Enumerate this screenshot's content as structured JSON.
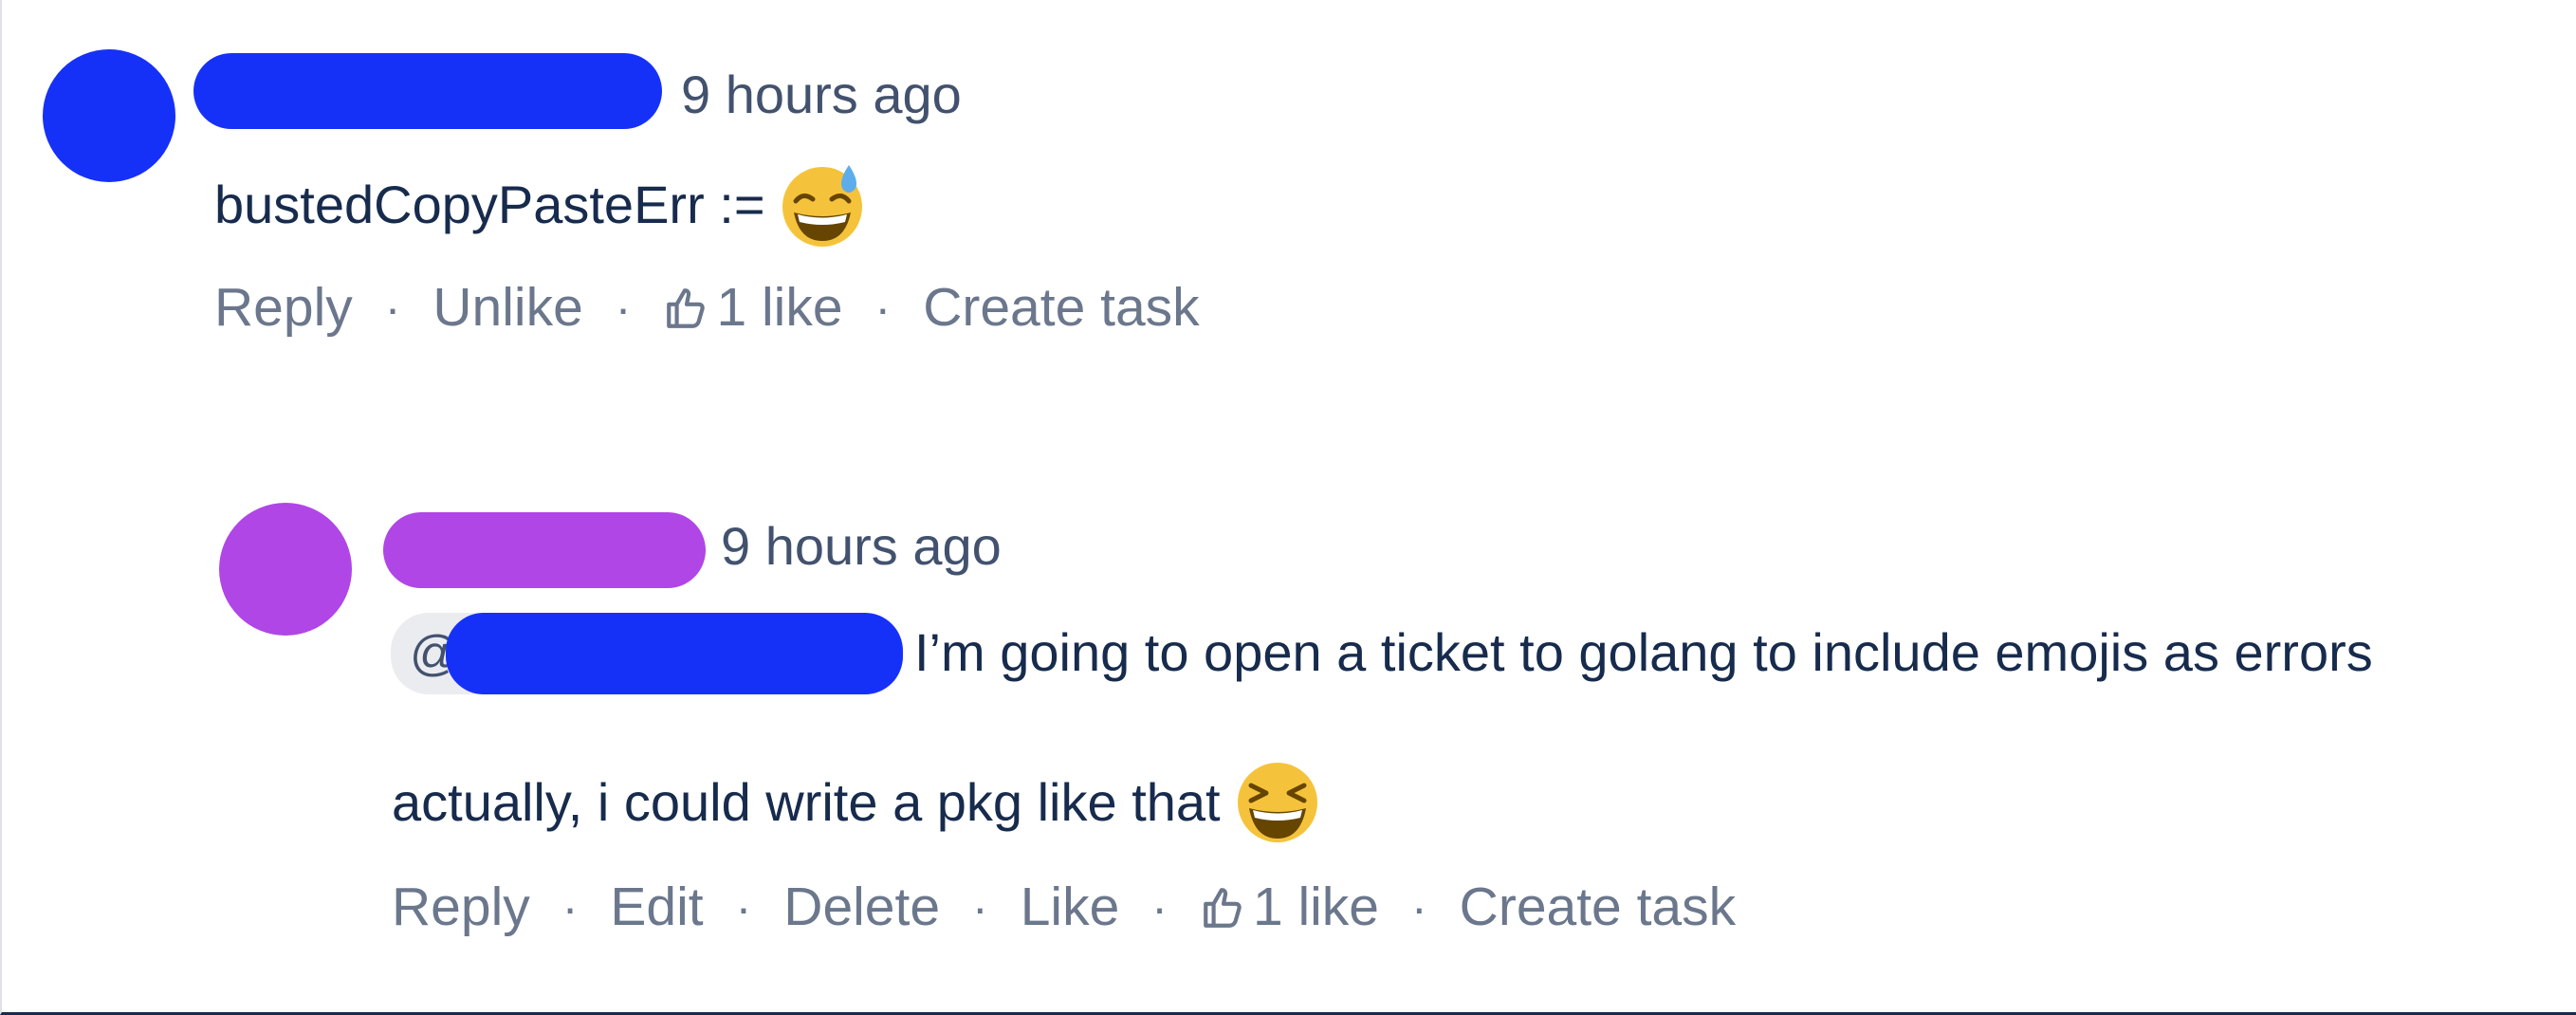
{
  "colors": {
    "comment1_accent": "#1631f7",
    "comment2_accent": "#b046e6",
    "action_text": "#6b778c",
    "body_text": "#172b4d",
    "mention_bg": "#ebecf0"
  },
  "comment1": {
    "time": "9 hours ago",
    "text": "bustedCopyPasteErr :=",
    "emoji": "grinning-face-with-sweat-emoji",
    "actions": {
      "reply": "Reply",
      "unlike": "Unlike",
      "like_count": "1 like",
      "create_task": "Create task"
    }
  },
  "comment2": {
    "time": "9 hours ago",
    "mention_prefix": "@",
    "text_line1": "I’m going to open a ticket to golang to include emojis as errors",
    "text_line2": "actually, i could write a pkg like that",
    "emoji": "grinning-squinting-face-emoji",
    "actions": {
      "reply": "Reply",
      "edit": "Edit",
      "delete": "Delete",
      "like": "Like",
      "like_count": "1 like",
      "create_task": "Create task"
    }
  },
  "separator": "·",
  "icons": [
    "thumbs-up-icon"
  ]
}
